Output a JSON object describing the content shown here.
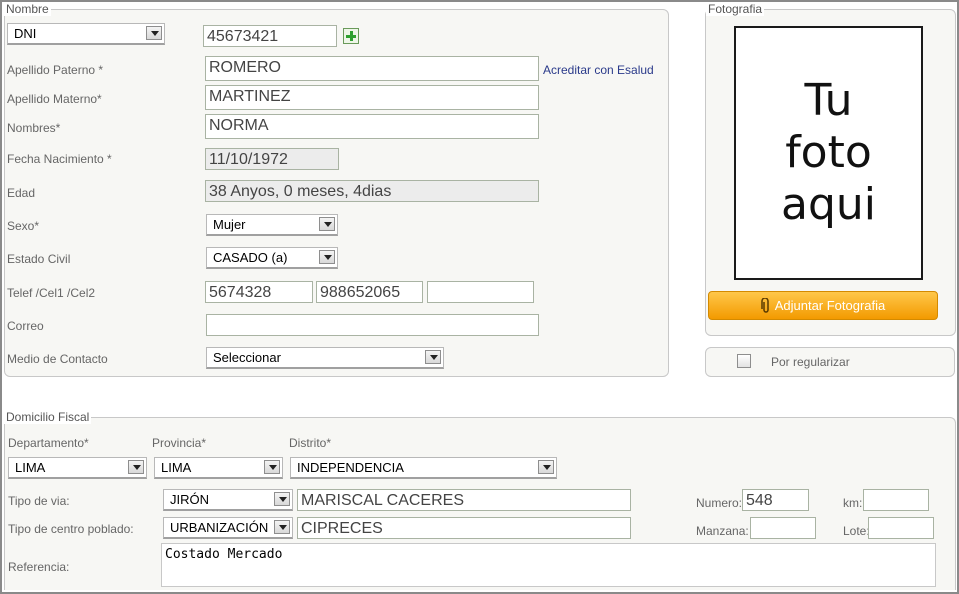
{
  "nombre_section": {
    "legend": "Nombre",
    "doc_type": "DNI",
    "doc_number": "45673421",
    "apellido_paterno_label": "Apellido Paterno *",
    "apellido_paterno_value": "ROMERO",
    "acreditar_link": "Acreditar con Esalud",
    "apellido_materno_label": "Apellido Materno*",
    "apellido_materno_value": "MARTINEZ",
    "nombres_label": "Nombres*",
    "nombres_value": "NORMA",
    "fecha_label": "Fecha Nacimiento *",
    "fecha_value": "11/10/1972",
    "edad_label": "Edad",
    "edad_value": "38 Anyos, 0 meses, 4dias",
    "sexo_label": "Sexo*",
    "sexo_value": "Mujer",
    "estado_label": "Estado Civil",
    "estado_value": "CASADO (a)",
    "telef_label": "Telef /Cel1 /Cel2",
    "telef_value": "5674328",
    "cel1_value": "988652065",
    "cel2_value": "",
    "correo_label": "Correo",
    "correo_value": "",
    "medio_label": "Medio de Contacto",
    "medio_value": "Seleccionar"
  },
  "foto_section": {
    "legend": "Fotografia",
    "placeholder": "Tu\nfoto\naqui",
    "button_label": "Adjuntar Fotografia",
    "button_icon": "paperclip-icon",
    "regularizar_label": "Por regularizar",
    "regularizar_checked": false
  },
  "domicilio_section": {
    "legend": "Domicilio Fiscal",
    "departamento_label": "Departamento*",
    "departamento_value": "LIMA",
    "provincia_label": "Provincia*",
    "provincia_value": "LIMA",
    "distrito_label": "Distrito*",
    "distrito_value": "INDEPENDENCIA",
    "tipo_via_label": "Tipo de via:",
    "tipo_via_value": "JIRÓN",
    "via_name_value": "MARISCAL CACERES",
    "numero_label": "Numero:",
    "numero_value": "548",
    "km_label": "km:",
    "km_value": "",
    "centro_label": "Tipo de centro poblado:",
    "centro_value": "URBANIZACIÓN",
    "centro_name_value": "CIPRECES",
    "manzana_label": "Manzana:",
    "manzana_value": "",
    "lote_label": "Lote:",
    "lote_value": "",
    "referencia_label": "Referencia:",
    "referencia_value": "Costado Mercado"
  },
  "colors": {
    "accent_orange": "#f39a00",
    "link_blue": "#2a3a8a",
    "panel_bg": "#f7f7f4"
  }
}
